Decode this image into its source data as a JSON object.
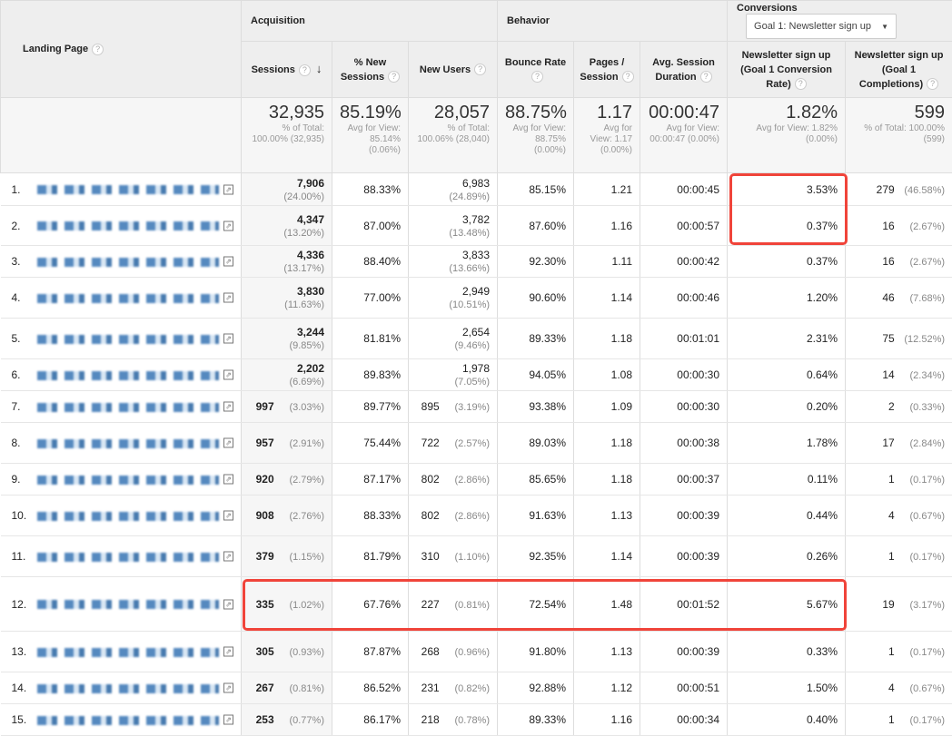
{
  "header": {
    "landing_page": "Landing Page",
    "acquisition": "Acquisition",
    "behavior": "Behavior",
    "conversions": "Conversions",
    "goal_select": "Goal 1: Newsletter sign up",
    "columns": [
      "Sessions",
      "% New Sessions",
      "New Users",
      "Bounce Rate",
      "Pages / Session",
      "Avg. Session Duration",
      "Newsletter sign up (Goal 1 Conversion Rate)",
      "Newsletter sign up (Goal 1 Completions)"
    ]
  },
  "totals": [
    {
      "v": "32,935",
      "s": "% of Total: 100.00% (32,935)"
    },
    {
      "v": "85.19%",
      "s": "Avg for View: 85.14% (0.06%)"
    },
    {
      "v": "28,057",
      "s": "% of Total: 100.06% (28,040)"
    },
    {
      "v": "88.75%",
      "s": "Avg for View: 88.75% (0.00%)"
    },
    {
      "v": "1.17",
      "s": "Avg for View: 1.17 (0.00%)"
    },
    {
      "v": "00:00:47",
      "s": "Avg for View: 00:00:47 (0.00%)"
    },
    {
      "v": "1.82%",
      "s": "Avg for View: 1.82% (0.00%)"
    },
    {
      "v": "599",
      "s": "% of Total: 100.00% (599)"
    }
  ],
  "rows": [
    {
      "n": "1.",
      "s": "7,906",
      "sp": "(24.00%)",
      "ns": "88.33%",
      "nu": "6,983",
      "nup": "(24.89%)",
      "br": "85.15%",
      "ps": "1.21",
      "d": "00:00:45",
      "cr": "3.53%",
      "c": "279",
      "cp": "(46.58%)"
    },
    {
      "n": "2.",
      "s": "4,347",
      "sp": "(13.20%)",
      "ns": "87.00%",
      "nu": "3,782",
      "nup": "(13.48%)",
      "br": "87.60%",
      "ps": "1.16",
      "d": "00:00:57",
      "cr": "0.37%",
      "c": "16",
      "cp": "(2.67%)"
    },
    {
      "n": "3.",
      "s": "4,336",
      "sp": "(13.17%)",
      "ns": "88.40%",
      "nu": "3,833",
      "nup": "(13.66%)",
      "br": "92.30%",
      "ps": "1.11",
      "d": "00:00:42",
      "cr": "0.37%",
      "c": "16",
      "cp": "(2.67%)"
    },
    {
      "n": "4.",
      "s": "3,830",
      "sp": "(11.63%)",
      "ns": "77.00%",
      "nu": "2,949",
      "nup": "(10.51%)",
      "br": "90.60%",
      "ps": "1.14",
      "d": "00:00:46",
      "cr": "1.20%",
      "c": "46",
      "cp": "(7.68%)"
    },
    {
      "n": "5.",
      "s": "3,244",
      "sp": "(9.85%)",
      "ns": "81.81%",
      "nu": "2,654",
      "nup": "(9.46%)",
      "br": "89.33%",
      "ps": "1.18",
      "d": "00:01:01",
      "cr": "2.31%",
      "c": "75",
      "cp": "(12.52%)"
    },
    {
      "n": "6.",
      "s": "2,202",
      "sp": "(6.69%)",
      "ns": "89.83%",
      "nu": "1,978",
      "nup": "(7.05%)",
      "br": "94.05%",
      "ps": "1.08",
      "d": "00:00:30",
      "cr": "0.64%",
      "c": "14",
      "cp": "(2.34%)"
    },
    {
      "n": "7.",
      "s": "997",
      "sp": "(3.03%)",
      "ns": "89.77%",
      "nu": "895",
      "nup": "(3.19%)",
      "br": "93.38%",
      "ps": "1.09",
      "d": "00:00:30",
      "cr": "0.20%",
      "c": "2",
      "cp": "(0.33%)"
    },
    {
      "n": "8.",
      "s": "957",
      "sp": "(2.91%)",
      "ns": "75.44%",
      "nu": "722",
      "nup": "(2.57%)",
      "br": "89.03%",
      "ps": "1.18",
      "d": "00:00:38",
      "cr": "1.78%",
      "c": "17",
      "cp": "(2.84%)"
    },
    {
      "n": "9.",
      "s": "920",
      "sp": "(2.79%)",
      "ns": "87.17%",
      "nu": "802",
      "nup": "(2.86%)",
      "br": "85.65%",
      "ps": "1.18",
      "d": "00:00:37",
      "cr": "0.11%",
      "c": "1",
      "cp": "(0.17%)"
    },
    {
      "n": "10.",
      "s": "908",
      "sp": "(2.76%)",
      "ns": "88.33%",
      "nu": "802",
      "nup": "(2.86%)",
      "br": "91.63%",
      "ps": "1.13",
      "d": "00:00:39",
      "cr": "0.44%",
      "c": "4",
      "cp": "(0.67%)"
    },
    {
      "n": "11.",
      "s": "379",
      "sp": "(1.15%)",
      "ns": "81.79%",
      "nu": "310",
      "nup": "(1.10%)",
      "br": "92.35%",
      "ps": "1.14",
      "d": "00:00:39",
      "cr": "0.26%",
      "c": "1",
      "cp": "(0.17%)"
    },
    {
      "n": "12.",
      "s": "335",
      "sp": "(1.02%)",
      "ns": "67.76%",
      "nu": "227",
      "nup": "(0.81%)",
      "br": "72.54%",
      "ps": "1.48",
      "d": "00:01:52",
      "cr": "5.67%",
      "c": "19",
      "cp": "(3.17%)"
    },
    {
      "n": "13.",
      "s": "305",
      "sp": "(0.93%)",
      "ns": "87.87%",
      "nu": "268",
      "nup": "(0.96%)",
      "br": "91.80%",
      "ps": "1.13",
      "d": "00:00:39",
      "cr": "0.33%",
      "c": "1",
      "cp": "(0.17%)"
    },
    {
      "n": "14.",
      "s": "267",
      "sp": "(0.81%)",
      "ns": "86.52%",
      "nu": "231",
      "nup": "(0.82%)",
      "br": "92.88%",
      "ps": "1.12",
      "d": "00:00:51",
      "cr": "1.50%",
      "c": "4",
      "cp": "(0.67%)"
    },
    {
      "n": "15.",
      "s": "253",
      "sp": "(0.77%)",
      "ns": "86.17%",
      "nu": "218",
      "nup": "(0.78%)",
      "br": "89.33%",
      "ps": "1.16",
      "d": "00:00:34",
      "cr": "0.40%",
      "c": "1",
      "cp": "(0.17%)"
    }
  ],
  "highlight_color": "#f0443a"
}
